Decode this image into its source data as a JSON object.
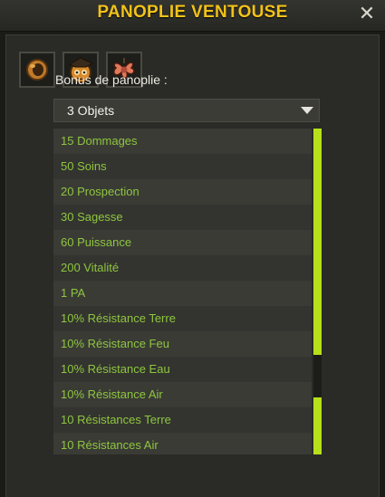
{
  "window": {
    "title": "PANOPLIE VENTOUSE",
    "close_icon": "close-icon"
  },
  "set_items": [
    {
      "icon": "ring-icon"
    },
    {
      "icon": "hat-icon"
    },
    {
      "icon": "amulet-icon"
    }
  ],
  "bonus": {
    "label": "Bonus de panoplie :",
    "selected": "3 Objets",
    "dropdown_icon": "chevron-down-icon"
  },
  "bonuses": [
    "15 Dommages",
    "50 Soins",
    "20 Prospection",
    "30 Sagesse",
    "60 Puissance",
    "200 Vitalité",
    "1 PA",
    "10% Résistance Terre",
    "10% Résistance Feu",
    "10% Résistance Eau",
    "10% Résistance Air",
    "10 Résistances Terre",
    "10 Résistances Air"
  ],
  "colors": {
    "title": "#f2c21a",
    "bonus_text": "#8ec63f",
    "scroll_thumb": "#b6e11a",
    "panel": "#2a2b26"
  }
}
